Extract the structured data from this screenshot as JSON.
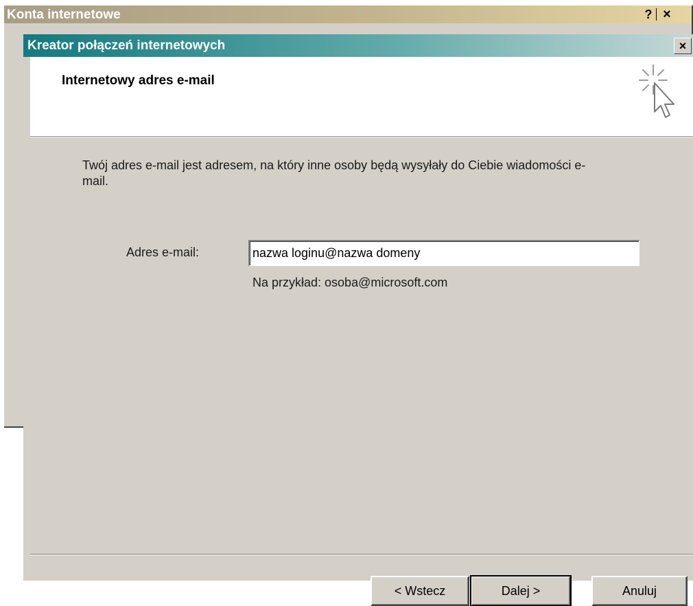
{
  "background_window": {
    "title": "Konta internetowe",
    "help_label": "?",
    "close_label": "×"
  },
  "wizard": {
    "title": "Kreator połączeń internetowych",
    "close_label": "×",
    "heading": "Internetowy adres e-mail",
    "intro_text": "Twój adres e-mail jest adresem, na który inne osoby będą wysyłały do Ciebie wiadomości e-mail.",
    "email_label": "Adres e-mail:",
    "email_value": "nazwa loginu@nazwa domeny",
    "example_text": "Na przykład: osoba@microsoft.com",
    "buttons": {
      "back": "< Wstecz",
      "next": "Dalej >",
      "cancel": "Anuluj"
    },
    "icon": "wizard-sparkle-cursor-icon"
  },
  "colors": {
    "wizard_titlebar": "#137a80",
    "background_titlebar": "#c4b58e",
    "dialog_face": "#d4d0c8"
  }
}
